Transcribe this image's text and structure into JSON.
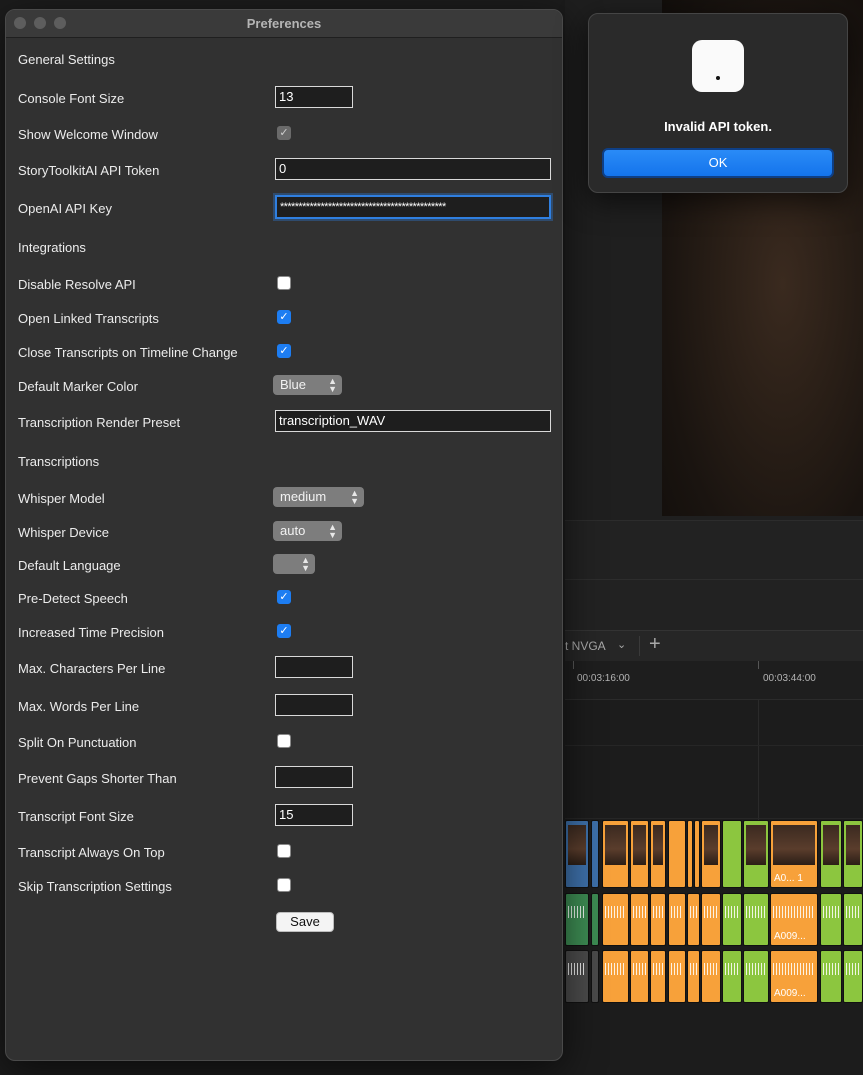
{
  "preferences": {
    "title": "Preferences",
    "sections": {
      "general": "General Settings",
      "integrations": "Integrations",
      "transcriptions": "Transcriptions"
    },
    "console_font_size": {
      "label": "Console Font Size",
      "value": "13"
    },
    "show_welcome_window": {
      "label": "Show Welcome Window",
      "checked": true,
      "disabled": true
    },
    "storytoolkit_api_token": {
      "label": "StoryToolkitAI API Token",
      "value": "0"
    },
    "openai_api_key": {
      "label": "OpenAI API Key",
      "value": "*********************************************"
    },
    "disable_resolve_api": {
      "label": "Disable Resolve API",
      "checked": false
    },
    "open_linked_transcripts": {
      "label": "Open Linked Transcripts",
      "checked": true
    },
    "close_transcripts_on_timeline_change": {
      "label": "Close Transcripts on Timeline Change",
      "checked": true
    },
    "default_marker_color": {
      "label": "Default Marker Color",
      "value": "Blue"
    },
    "transcription_render_preset": {
      "label": "Transcription Render Preset",
      "value": "transcription_WAV"
    },
    "whisper_model": {
      "label": "Whisper Model",
      "value": "medium"
    },
    "whisper_device": {
      "label": "Whisper Device",
      "value": "auto"
    },
    "default_language": {
      "label": "Default Language",
      "value": ""
    },
    "pre_detect_speech": {
      "label": "Pre-Detect Speech",
      "checked": true
    },
    "increased_time_precision": {
      "label": "Increased Time Precision",
      "checked": true
    },
    "max_characters_per_line": {
      "label": "Max. Characters Per Line",
      "value": ""
    },
    "max_words_per_line": {
      "label": "Max. Words Per Line",
      "value": ""
    },
    "split_on_punctuation": {
      "label": "Split On Punctuation",
      "checked": false
    },
    "prevent_gaps_shorter_than": {
      "label": "Prevent Gaps Shorter Than",
      "value": ""
    },
    "transcript_font_size": {
      "label": "Transcript Font Size",
      "value": "15"
    },
    "transcript_always_on_top": {
      "label": "Transcript Always On Top",
      "checked": false
    },
    "skip_transcription_settings": {
      "label": "Skip Transcription Settings",
      "checked": false
    },
    "save_label": "Save"
  },
  "alert": {
    "message": "Invalid API token.",
    "ok_label": "OK",
    "icon": "app-icon"
  },
  "background": {
    "timeline_name": "t NVGA",
    "timecodes": [
      "00:03:16:00",
      "00:03:44:00"
    ],
    "clip_labels": [
      "A0... 1",
      "A009...",
      "A009..."
    ]
  },
  "colors": {
    "accent_blue": "#1d7df2",
    "clip_orange": "#f7a13a",
    "clip_green": "#8cc63f",
    "clip_blue": "#3d6fa8",
    "audio_green": "#3c8a52"
  }
}
